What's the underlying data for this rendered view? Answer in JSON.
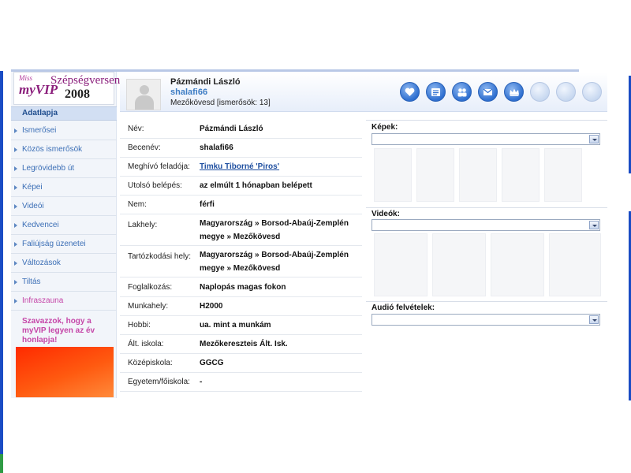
{
  "logo": {
    "script_text": "Miss",
    "brand": "myVIP",
    "title": "Szépségverseny",
    "year": "2008"
  },
  "sidebar": {
    "active_item": "Adatlapja",
    "items": [
      {
        "label": "Ismerősei"
      },
      {
        "label": "Közös ismerősök"
      },
      {
        "label": "Legrövidebb út"
      },
      {
        "label": "Képei"
      },
      {
        "label": "Videói"
      },
      {
        "label": "Kedvencei"
      },
      {
        "label": "Faliújság üzenetei"
      },
      {
        "label": "Változások"
      },
      {
        "label": "Tiltás"
      },
      {
        "label": "Infraszauna"
      }
    ],
    "vote_link": "Szavazzok, hogy a myVIP legyen az év honlapja!"
  },
  "profile": {
    "name": "Pázmándi László",
    "nickname": "shalafi66",
    "location_line": "Mezőkövesd [ismerősök: 13]"
  },
  "header_icons": [
    "heart-icon",
    "notes-icon",
    "people-icon",
    "mail-icon",
    "crown-icon"
  ],
  "info": [
    {
      "label": "Név:",
      "value": "Pázmándi László"
    },
    {
      "label": "Becenév:",
      "value": "shalafi66"
    },
    {
      "label": "Meghívó feladója:",
      "value": "Timku Tiborné 'Piros'"
    },
    {
      "label": "Utolsó belépés:",
      "value": "az elmúlt 1 hónapban belépett"
    },
    {
      "label": "Nem:",
      "value": "férfi"
    },
    {
      "label": "Lakhely:",
      "value": "Magyarország » Borsod-Abaúj-Zemplén megye » Mezőkövesd"
    },
    {
      "label": "Tartózkodási hely:",
      "value": "Magyarország » Borsod-Abaúj-Zemplén megye » Mezőkövesd"
    },
    {
      "label": "Foglalkozás:",
      "value": "Naplopás magas fokon"
    },
    {
      "label": "Munkahely:",
      "value": "H2000"
    },
    {
      "label": "Hobbi:",
      "value": "ua. mint a munkám"
    },
    {
      "label": "Ált. iskola:",
      "value": "Mezőkereszteis Ált. Isk."
    },
    {
      "label": "Középiskola:",
      "value": "GGCG"
    },
    {
      "label": "Egyetem/főiskola:",
      "value": "-"
    }
  ],
  "media": {
    "pictures_title": "Képek:",
    "videos_title": "Videók:",
    "audio_title": "Audió felvételek:"
  },
  "colors": {
    "link_blue": "#3c6fb6",
    "pink": "#c546a8",
    "button_blue": "#2e6fd0"
  }
}
